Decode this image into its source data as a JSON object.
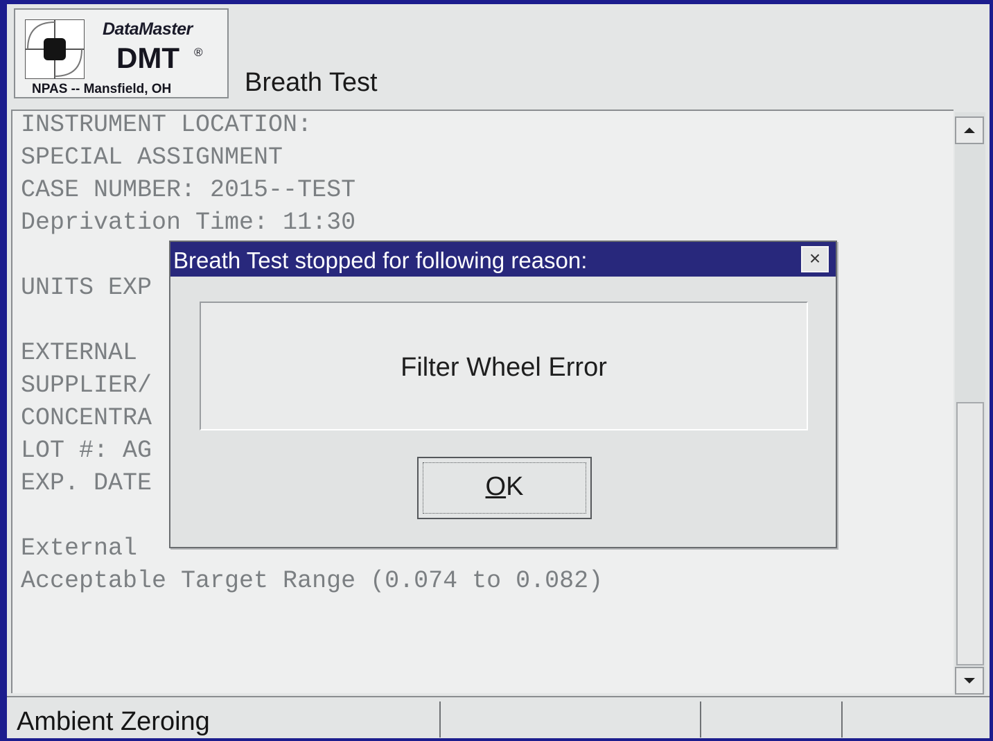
{
  "logo": {
    "brand": "DataMaster",
    "product": "DMT",
    "registered": "®",
    "org": "NPAS -- Mansfield, OH"
  },
  "app_title": "Breath Test",
  "text_lines": [
    "INSTRUMENT LOCATION:",
    "SPECIAL ASSIGNMENT",
    "CASE NUMBER: 2015--TEST",
    "Deprivation Time: 11:30",
    "",
    "UNITS EXP",
    "",
    "EXTERNAL ",
    "SUPPLIER/",
    "CONCENTRA",
    "LOT #: AG",
    "EXP. DATE",
    "",
    "External ",
    "Acceptable Target Range (0.074 to 0.082)"
  ],
  "dialog": {
    "title": "Breath Test stopped for following reason:",
    "close_label": "×",
    "message": "Filter Wheel Error",
    "ok_mnemonic": "O",
    "ok_rest": "K"
  },
  "status_bar": {
    "cells": [
      "Ambient Zeroing",
      "",
      "",
      ""
    ]
  },
  "colors": {
    "bezel": "#1c1d8e",
    "titlebar": "#28287c",
    "screen": "#e4e6e6"
  },
  "icons": {
    "logo_mark": "datamaster-logo",
    "scroll_up": "triangle-up-icon",
    "scroll_down": "triangle-down-icon",
    "close": "close-icon"
  }
}
